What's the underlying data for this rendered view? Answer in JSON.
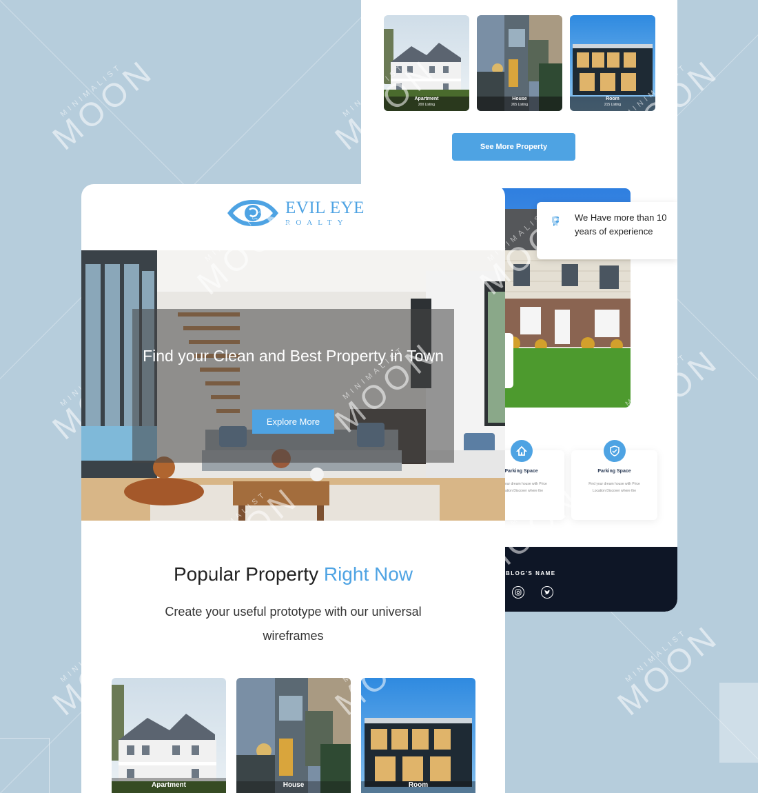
{
  "watermark": {
    "small": "MINIMALIST",
    "large": "MOON"
  },
  "back": {
    "cards": [
      {
        "label": "Apartment",
        "count": "200 Listing"
      },
      {
        "label": "House",
        "count": "265 Listing"
      },
      {
        "label": "Room",
        "count": "215 Listing"
      }
    ],
    "see_more": "See More Property",
    "experience": "We Have more than 10 years of experience",
    "features": [
      {
        "title": "Parking Space",
        "desc": "Find your dream house with Price Location Discover where the"
      },
      {
        "title": "Parking Space",
        "desc": "Find your dream house with Price Location Discover where the"
      }
    ],
    "footer": {
      "blog_name": "BLOG'S NAME"
    }
  },
  "front": {
    "logo": {
      "line1": "EVIL EYE",
      "line2": "ROALTY"
    },
    "hero": {
      "title": "Find your Clean and Best Property in Town",
      "button": "Explore More"
    },
    "popular": {
      "title_main": "Popular Property",
      "title_accent": "Right Now",
      "subtitle": "Create your useful prototype with our universal wireframes"
    },
    "cards": [
      {
        "label": "Apartment"
      },
      {
        "label": "House"
      },
      {
        "label": "Room"
      }
    ]
  },
  "colors": {
    "accent": "#4ea3e3",
    "background": "#b6cddc",
    "dark": "#0e1626"
  }
}
